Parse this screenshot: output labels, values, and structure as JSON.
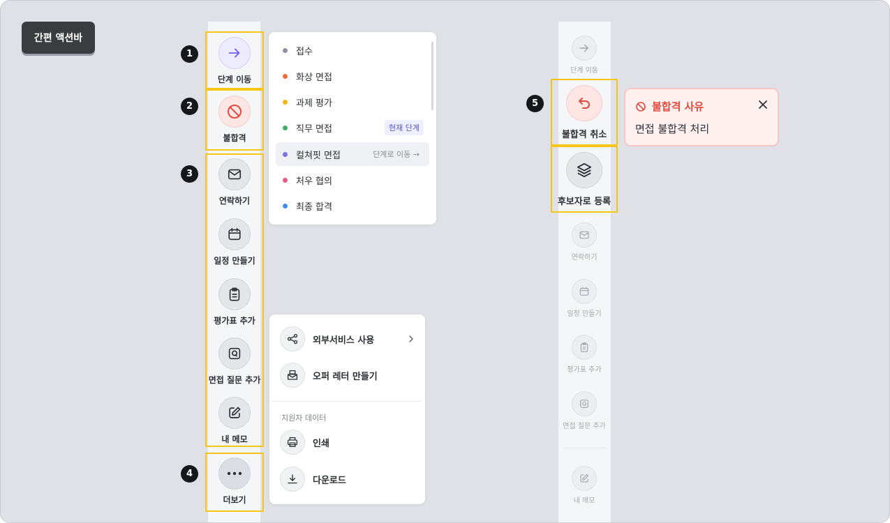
{
  "title": "간편 액션바",
  "markers": [
    "1",
    "2",
    "3",
    "4",
    "5"
  ],
  "left_bar": {
    "move_stage": {
      "label": "단계 이동",
      "icon": "arrow-right-icon"
    },
    "reject": {
      "label": "불합격",
      "icon": "ban-icon"
    },
    "contact": {
      "label": "연락하기",
      "icon": "mail-icon"
    },
    "schedule": {
      "label": "일정 만들기",
      "icon": "calendar-icon"
    },
    "evaluation": {
      "label": "평가표 추가",
      "icon": "clipboard-icon"
    },
    "interview_question": {
      "label": "면접 질문 추가",
      "icon": "question-box-icon"
    },
    "memo": {
      "label": "내 메모",
      "icon": "edit-icon"
    },
    "more": {
      "label": "더보기",
      "icon": "more-dots-icon"
    }
  },
  "stage_menu": {
    "items": [
      {
        "label": "접수",
        "color": "#8e929a"
      },
      {
        "label": "화상 면접",
        "color": "#f26b3a"
      },
      {
        "label": "과제 평가",
        "color": "#f5b21c"
      },
      {
        "label": "직무 면접",
        "color": "#3fae6a",
        "tag": "현재 단계"
      },
      {
        "label": "컬쳐핏 면접",
        "color": "#7b72e0",
        "hint": "단계로 이동 →"
      },
      {
        "label": "처우 협의",
        "color": "#e85a8c"
      },
      {
        "label": "최종 합격",
        "color": "#3d8ef0"
      }
    ]
  },
  "more_menu": {
    "external_service": "외부서비스 사용",
    "offer_letter": "오퍼 레터 만들기",
    "section_label": "지원자 데이터",
    "print": "인쇄",
    "download": "다운로드"
  },
  "right_bar": {
    "move_stage": "단계 이동",
    "cancel_reject": "불합격 취소",
    "register_candidate": "후보자로 등록",
    "contact": "연락하기",
    "schedule": "일정 만들기",
    "evaluation": "평가표 추가",
    "interview_question": "면접 질문 추가",
    "memo": "내 메모"
  },
  "reject_reason": {
    "title": "불합격 사유",
    "body": "면접 불합격 처리"
  },
  "colors": {
    "highlight": "#f5c518",
    "accent_purple": "#6b5cf0",
    "reject_red": "#e3493c"
  }
}
